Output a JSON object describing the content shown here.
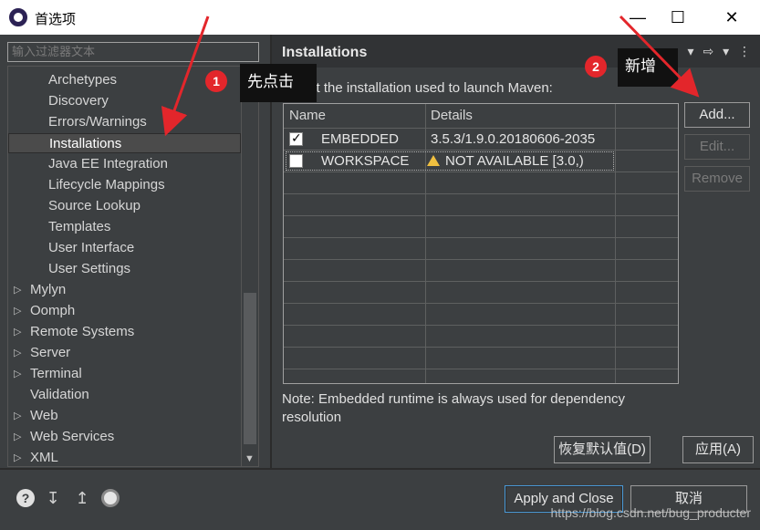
{
  "window": {
    "title": "首选项"
  },
  "filter": {
    "placeholder": "输入过滤器文本"
  },
  "tree": {
    "items": [
      {
        "label": "Archetypes",
        "indent": true,
        "expandable": false
      },
      {
        "label": "Discovery",
        "indent": true,
        "expandable": false
      },
      {
        "label": "Errors/Warnings",
        "indent": true,
        "expandable": false
      },
      {
        "label": "Installations",
        "indent": true,
        "expandable": false,
        "selected": true
      },
      {
        "label": "Java EE Integration",
        "indent": true,
        "expandable": false
      },
      {
        "label": "Lifecycle Mappings",
        "indent": true,
        "expandable": false
      },
      {
        "label": "Source Lookup",
        "indent": true,
        "expandable": false
      },
      {
        "label": "Templates",
        "indent": true,
        "expandable": false
      },
      {
        "label": "User Interface",
        "indent": true,
        "expandable": false
      },
      {
        "label": "User Settings",
        "indent": true,
        "expandable": false
      },
      {
        "label": "Mylyn",
        "indent": false,
        "expandable": true
      },
      {
        "label": "Oomph",
        "indent": false,
        "expandable": true
      },
      {
        "label": "Remote Systems",
        "indent": false,
        "expandable": true
      },
      {
        "label": "Server",
        "indent": false,
        "expandable": true
      },
      {
        "label": "Terminal",
        "indent": false,
        "expandable": true
      },
      {
        "label": "Validation",
        "indent": false,
        "expandable": false
      },
      {
        "label": "Web",
        "indent": false,
        "expandable": true
      },
      {
        "label": "Web Services",
        "indent": false,
        "expandable": true
      },
      {
        "label": "XML",
        "indent": false,
        "expandable": true
      }
    ]
  },
  "page": {
    "title": "Installations",
    "description": "Select the installation used to launch Maven:",
    "note": "Note: Embedded runtime is always used for dependency resolution"
  },
  "table": {
    "headers": {
      "name": "Name",
      "details": "Details"
    },
    "rows": [
      {
        "checked": true,
        "name": "EMBEDDED",
        "details": "3.5.3/1.9.0.20180606-2035",
        "warning": false
      },
      {
        "checked": false,
        "name": "WORKSPACE",
        "details": "NOT AVAILABLE [3.0,)",
        "warning": true
      }
    ]
  },
  "buttons": {
    "add": "Add...",
    "edit": "Edit...",
    "remove": "Remove",
    "restore_defaults": "恢复默认值(D)",
    "apply": "应用(A)",
    "apply_and_close": "Apply and Close",
    "cancel": "取消"
  },
  "annotations": {
    "step1": {
      "number": "1",
      "text": "先点击"
    },
    "step2": {
      "number": "2",
      "text": "新增"
    }
  },
  "watermark": "https://blog.csdn.net/bug_producter",
  "colors": {
    "background": "#3c3f41",
    "header": "#313335",
    "badge": "#e3262b",
    "arrow": "#e3262b"
  }
}
